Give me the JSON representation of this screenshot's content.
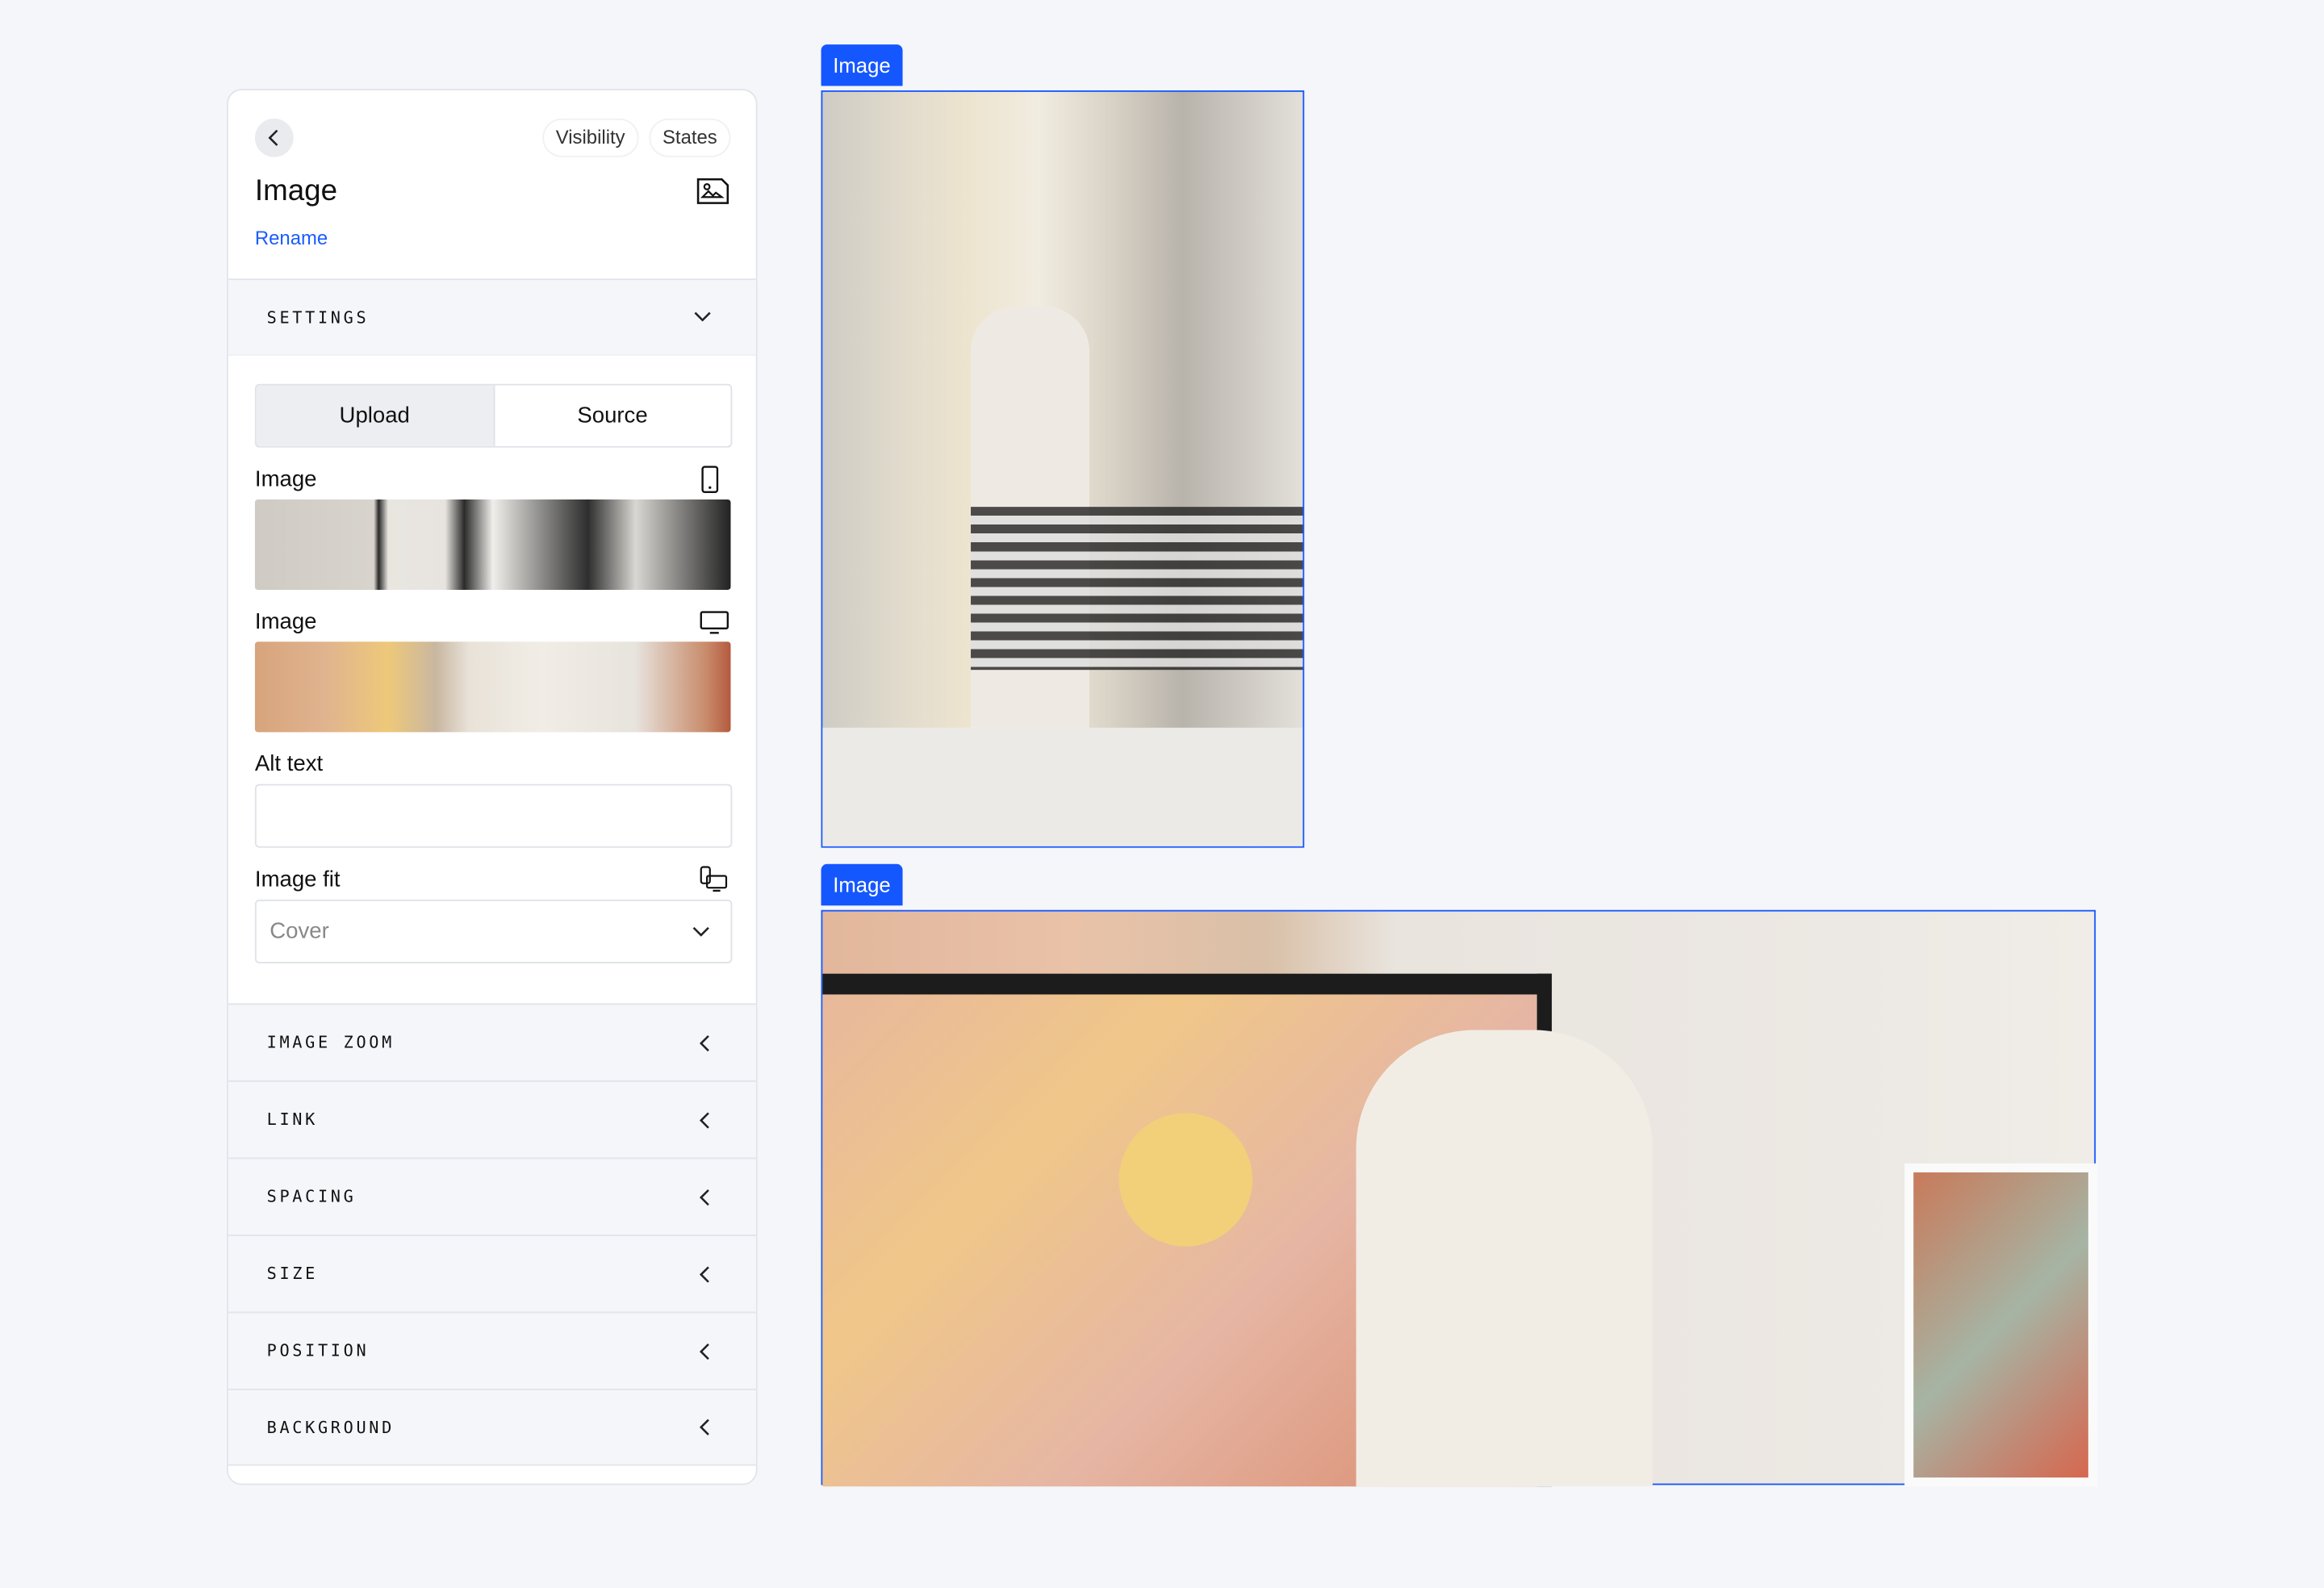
{
  "panel": {
    "back_icon": "chevron-left-icon",
    "tabs": [
      "Visibility",
      "States"
    ],
    "title": "Image",
    "title_icon": "image-icon",
    "rename": "Rename",
    "settings": {
      "label": "SETTINGS",
      "icon": "chevron-down-icon"
    },
    "segment": {
      "options": [
        "Upload",
        "Source"
      ],
      "selected": "Upload"
    },
    "mobile_image": {
      "label": "Image",
      "icon": "mobile-icon"
    },
    "desktop_image": {
      "label": "Image",
      "icon": "desktop-icon"
    },
    "alt_text": {
      "label": "Alt text",
      "value": ""
    },
    "image_fit": {
      "label": "Image fit",
      "icon": "responsive-devices-icon",
      "value": "Cover"
    },
    "sections": [
      "IMAGE ZOOM",
      "LINK",
      "SPACING",
      "SIZE",
      "POSITION",
      "BACKGROUND"
    ]
  },
  "canvas": {
    "tags": [
      "Image",
      "Image"
    ],
    "accent": "#1557ff"
  }
}
